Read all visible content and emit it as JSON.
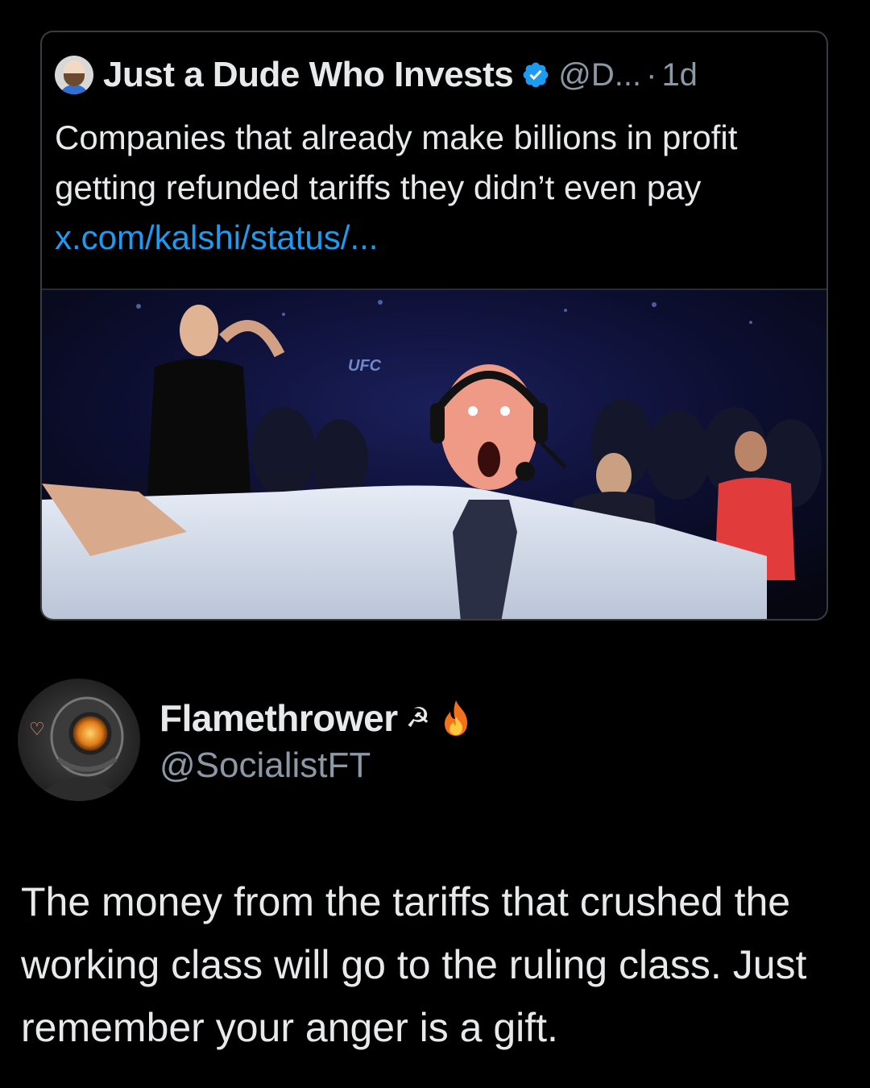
{
  "quoted_tweet": {
    "author_name": "Just a Dude Who Invests",
    "handle": "@D...",
    "separator": "·",
    "time": "1d",
    "text_before_link": "Companies that already make billions in profit getting refunded tariffs they didn’t even pay ",
    "link_text": "x.com/kalshi/status/...",
    "media_overlay_text": "UFC"
  },
  "reply_tweet": {
    "author_name": "Flamethrower",
    "name_symbol": "☭",
    "handle": "@SocialistFT",
    "text": "The money from the tariffs that crushed the working class will go to the ruling class. Just remember your anger is a gift."
  },
  "colors": {
    "background": "#000000",
    "link": "#1d9bf0",
    "verified": "#1d9bf0",
    "secondary_text": "#8b98a5"
  },
  "icons": {
    "verified": "verified-badge-icon",
    "fire": "fire-emoji-icon"
  }
}
